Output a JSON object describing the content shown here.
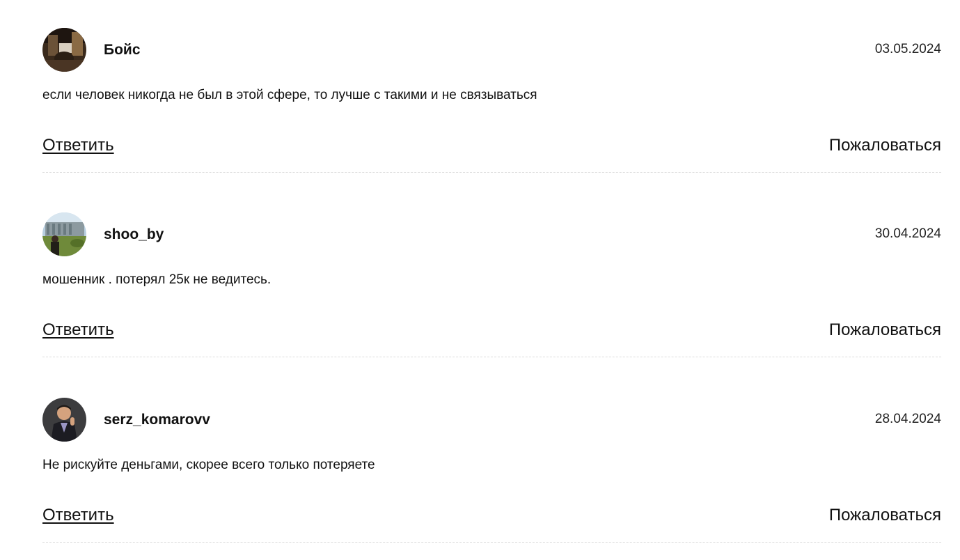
{
  "comments": [
    {
      "author": "Бойс",
      "date": "03.05.2024",
      "text": "если человек никогда не был в этой сфере, то лучше с такими и не связываться",
      "reply_label": "Ответить",
      "report_label": "Пожаловаться",
      "avatar_icon": "user-photo-avatar"
    },
    {
      "author": "shoo_by",
      "date": "30.04.2024",
      "text": "мошенник . потерял 25к не ведитесь.",
      "reply_label": "Ответить",
      "report_label": "Пожаловаться",
      "avatar_icon": "user-photo-avatar"
    },
    {
      "author": "serz_komarovv",
      "date": "28.04.2024",
      "text": "Не рискуйте деньгами, скорее всего только потеряете",
      "reply_label": "Ответить",
      "report_label": "Пожаловаться",
      "avatar_icon": "user-photo-avatar"
    }
  ]
}
